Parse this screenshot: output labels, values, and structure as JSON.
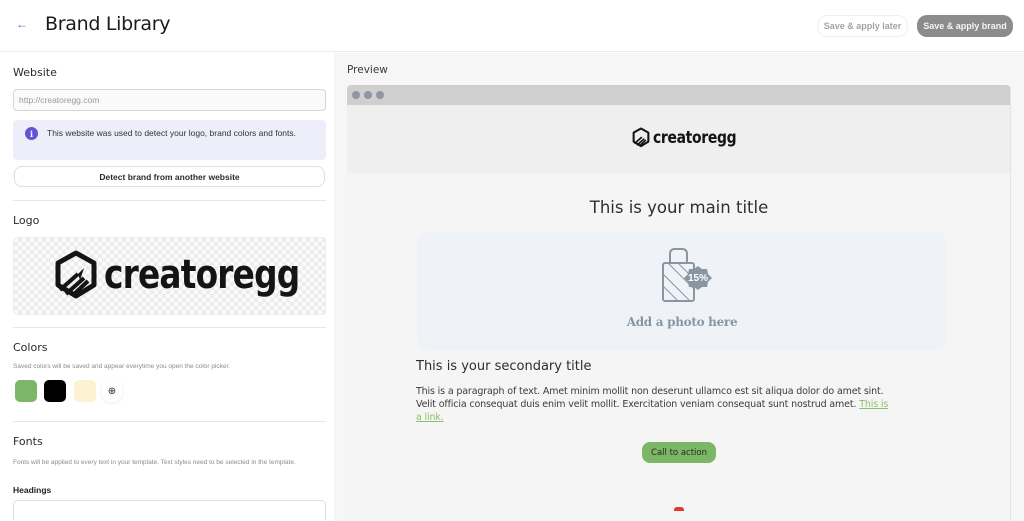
{
  "header": {
    "title": "Brand Library",
    "back_icon": "arrow-left-icon",
    "save_later_label": "Save & apply later",
    "save_apply_label": "Save & apply brand"
  },
  "left_panel": {
    "website": {
      "title": "Website",
      "url_value": "http://creatoregg.com",
      "info_icon": "info-icon",
      "info_text": "This website was used to detect your logo, brand colors and fonts.",
      "detect_button_label": "Detect brand from another website"
    },
    "logo": {
      "title": "Logo",
      "wordmark": "creatoregg"
    },
    "colors": {
      "title": "Colors",
      "description": "Saved colors will be saved and appear everytime you open the color picker.",
      "swatches": [
        "#7cb667",
        "#000000",
        "#fdf3d3"
      ],
      "add_icon": "plus-circle-icon"
    },
    "fonts": {
      "title": "Fonts",
      "description": "Fonts will be applied to every text in your template. Text styles need to be selected in the template.",
      "headings_label": "Headings"
    }
  },
  "preview": {
    "label": "Preview",
    "logo_wordmark": "creatoregg",
    "main_title": "This is your main title",
    "photo_placeholder": "Add a photo here",
    "badge_text": "15%",
    "secondary_title": "This is your secondary title",
    "paragraph": "This is a paragraph of text. Amet minim mollit non deserunt ullamco est sit aliqua dolor do amet sint. Velit officia consequat duis enim velit mollit. Exercitation veniam consequat sunt nostrud amet.",
    "link_text": "This is a link.",
    "cta_label": "Call to action"
  }
}
